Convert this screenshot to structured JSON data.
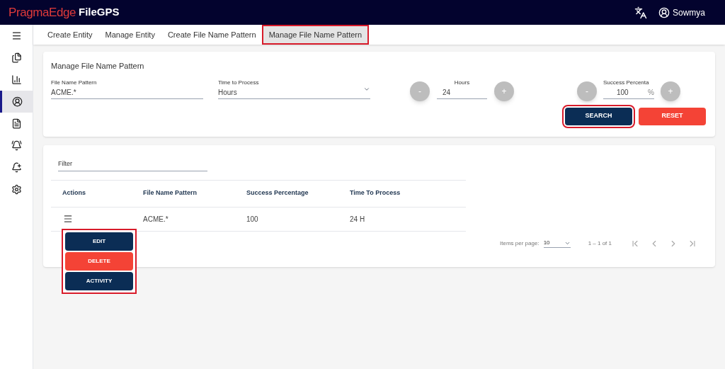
{
  "header": {
    "brand": "PragmaEdge",
    "product": "FileGPS",
    "user": "Sowmya"
  },
  "sidebar": {
    "items": [
      {
        "kind": "menu",
        "selected": false
      },
      {
        "kind": "files",
        "selected": false
      },
      {
        "kind": "chart",
        "selected": false
      },
      {
        "kind": "account",
        "selected": true
      },
      {
        "kind": "document",
        "selected": false
      },
      {
        "kind": "alert",
        "selected": false
      },
      {
        "kind": "alert-add",
        "selected": false
      },
      {
        "kind": "settings",
        "selected": false
      }
    ]
  },
  "tabs": [
    {
      "label": "Create Entity",
      "selected": false,
      "highlighted": false
    },
    {
      "label": "Manage Entity",
      "selected": false,
      "highlighted": false
    },
    {
      "label": "Create File Name Pattern",
      "selected": false,
      "highlighted": false
    },
    {
      "label": "Manage File Name Pattern",
      "selected": true,
      "highlighted": true
    }
  ],
  "search_form": {
    "title": "Manage File Name Pattern",
    "file_name_pattern": {
      "label": "File Name Pattern",
      "value": "ACME.*"
    },
    "time_to_process": {
      "label": "Time to Process",
      "value": "Hours"
    },
    "hours": {
      "label": "Hours",
      "value": "24",
      "minus": "-",
      "plus": "+"
    },
    "success": {
      "label": "Success Percenta",
      "value": "100",
      "unit": "%",
      "minus": "-",
      "plus": "+"
    },
    "buttons": [
      {
        "label": "SEARCH",
        "kind": "primary",
        "highlighted": true
      },
      {
        "label": "RESET",
        "kind": "danger",
        "highlighted": false
      }
    ]
  },
  "results": {
    "filter": {
      "placeholder": "Filter"
    },
    "columns": [
      "Actions",
      "File Name Pattern",
      "Success Percentage",
      "Time To Process"
    ],
    "rows": [
      {
        "pattern": "ACME.*",
        "success": "100",
        "time": "24 H"
      }
    ],
    "action_menu": {
      "highlighted": true,
      "items": [
        {
          "label": "EDIT",
          "kind": "primary"
        },
        {
          "label": "DELETE",
          "kind": "danger"
        },
        {
          "label": "ACTIVITY",
          "kind": "primary"
        }
      ]
    },
    "paginator": {
      "label": "Items per page:",
      "page_size": "10",
      "range": "1 – 1 of 1"
    }
  }
}
